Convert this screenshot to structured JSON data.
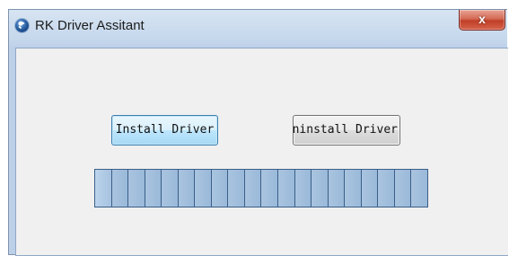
{
  "window": {
    "title": "RK Driver Assitant",
    "close_label": "x"
  },
  "buttons": {
    "install_label": "Install Driver",
    "uninstall_label": "Uninstall Driver"
  },
  "progress": {
    "segments": 20,
    "value": 1.0
  },
  "colors": {
    "progress_fill": "#9ab9d9",
    "progress_border": "#3a5f88",
    "close_button": "#c03f28"
  },
  "icons": {
    "app": "rk-app-icon",
    "close": "close-icon"
  }
}
